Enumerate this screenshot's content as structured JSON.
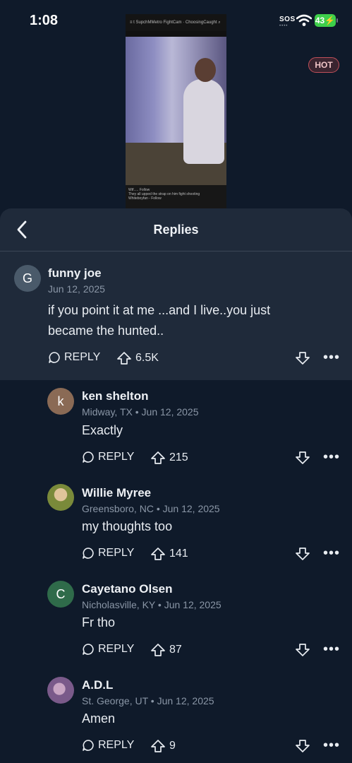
{
  "status_bar": {
    "time": "1:08",
    "sos": "SOS",
    "sos_dots": "••••",
    "battery": "43"
  },
  "video": {
    "top_tabs": "≡  t  SupchMMetro  FightCam ·  ChoosingCaught  ⌕",
    "caption": "Wtf.....   Follow",
    "caption2": "They all upped the strap on him fight shooting",
    "caption3": "Whiteboyfan - Follow",
    "caption4": "They all upped the strap on..."
  },
  "header": {
    "title": "Replies"
  },
  "comments": [
    {
      "avatar_letter": "G",
      "avatar_color": "#4a5a6a",
      "author": "funny joe",
      "location": "",
      "date": "Jun 12, 2025",
      "text_line1": "if you point it at me ...and I live..you just",
      "text_line2": "became the hunted..",
      "badge": "HOT",
      "reply_label": "REPLY",
      "votes": "6.5K"
    },
    {
      "avatar_letter": "k",
      "avatar_color": "#8a6a55",
      "author": "ken shelton",
      "location": "Midway, TX",
      "date": "Jun 12, 2025",
      "text": "Exactly",
      "reply_label": "REPLY",
      "votes": "215"
    },
    {
      "avatar_letter": "",
      "avatar_color": "#7a8a3a",
      "author": "Willie Myree",
      "location": "Greensboro, NC",
      "date": "Jun 12, 2025",
      "text": "my thoughts too",
      "reply_label": "REPLY",
      "votes": "141"
    },
    {
      "avatar_letter": "C",
      "avatar_color": "#2f6b4a",
      "author": "Cayetano Olsen",
      "location": "Nicholasville, KY",
      "date": "Jun 12, 2025",
      "text": "Fr tho",
      "reply_label": "REPLY",
      "votes": "87"
    },
    {
      "avatar_letter": "",
      "avatar_color": "#7a5a8a",
      "author": "A.D.L",
      "location": "St. George, UT",
      "date": "Jun 12, 2025",
      "text": "Amen",
      "reply_label": "REPLY",
      "votes": "9"
    }
  ],
  "meta_separator": " • ",
  "more_glyph": "•••"
}
